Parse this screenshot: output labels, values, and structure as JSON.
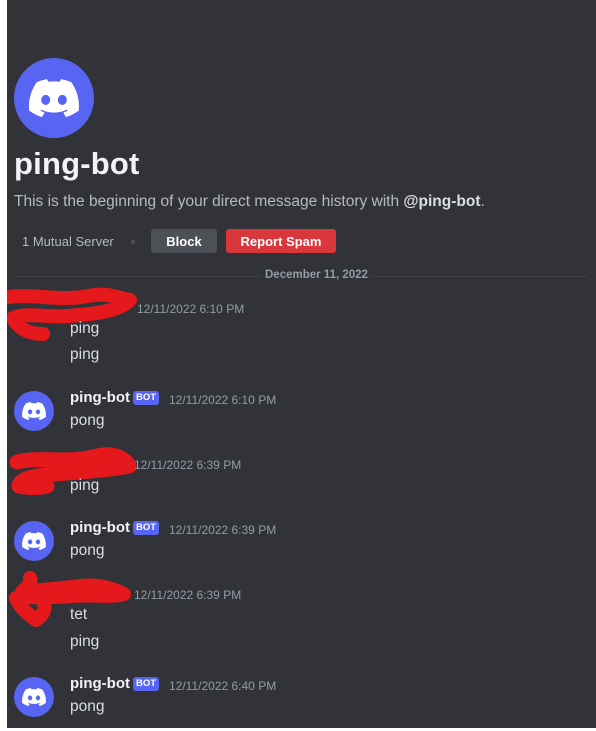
{
  "header": {
    "name": "ping-bot",
    "intro_prefix": "This is the beginning of your direct message history with ",
    "intro_handle": "@ping-bot",
    "intro_suffix": ".",
    "mutual_servers": "1 Mutual Server",
    "block_label": "Block",
    "report_label": "Report Spam"
  },
  "divider": {
    "date": "December 11, 2022"
  },
  "messages": [
    {
      "author": "",
      "redacted": true,
      "timestamp": "12/11/2022 6:10 PM",
      "lines": [
        "ping",
        "ping"
      ]
    },
    {
      "author": "ping-bot",
      "badge": "BOT",
      "timestamp": "12/11/2022 6:10 PM",
      "lines": [
        "pong"
      ]
    },
    {
      "author": "",
      "redacted": true,
      "timestamp": "12/11/2022 6:39 PM",
      "lines": [
        "ping"
      ]
    },
    {
      "author": "ping-bot",
      "badge": "BOT",
      "timestamp": "12/11/2022 6:39 PM",
      "lines": [
        "pong"
      ]
    },
    {
      "author": "",
      "redacted": true,
      "timestamp": "12/11/2022 6:39 PM",
      "lines": [
        "tet",
        "ping"
      ]
    },
    {
      "author": "ping-bot",
      "badge": "BOT",
      "timestamp": "12/11/2022 6:40 PM",
      "lines": [
        "pong"
      ]
    }
  ],
  "colors": {
    "background": "#313338",
    "blurple": "#5865f2",
    "danger": "#da373c",
    "redaction": "#e5181b"
  },
  "icons": {
    "avatar": "discord-logo-icon"
  }
}
